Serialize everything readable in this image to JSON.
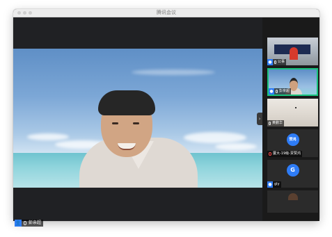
{
  "window": {
    "title": "腾讯会议"
  },
  "main": {
    "speaker_name": "彭亲超",
    "avatar_initial": "👤"
  },
  "sidebar": {
    "collapse_arrow": "›",
    "participants": [
      {
        "name": "公事",
        "muted": false,
        "has_video": true,
        "active": false
      },
      {
        "name": "彭亲超",
        "muted": false,
        "has_video": true,
        "active": true
      },
      {
        "name": "黄鹏华",
        "muted": false,
        "has_video": true,
        "active": false
      },
      {
        "name": "厦大-19级-贾赞鸿",
        "muted": true,
        "has_video": false,
        "avatar_text": "赞鸿",
        "active": false
      },
      {
        "name": "gly",
        "muted": false,
        "has_video": false,
        "avatar_text": "G",
        "active": false
      }
    ]
  },
  "colors": {
    "accent_green": "#19c37d",
    "avatar_blue": "#2e7cf6",
    "muted_red": "#ff4a4a"
  }
}
